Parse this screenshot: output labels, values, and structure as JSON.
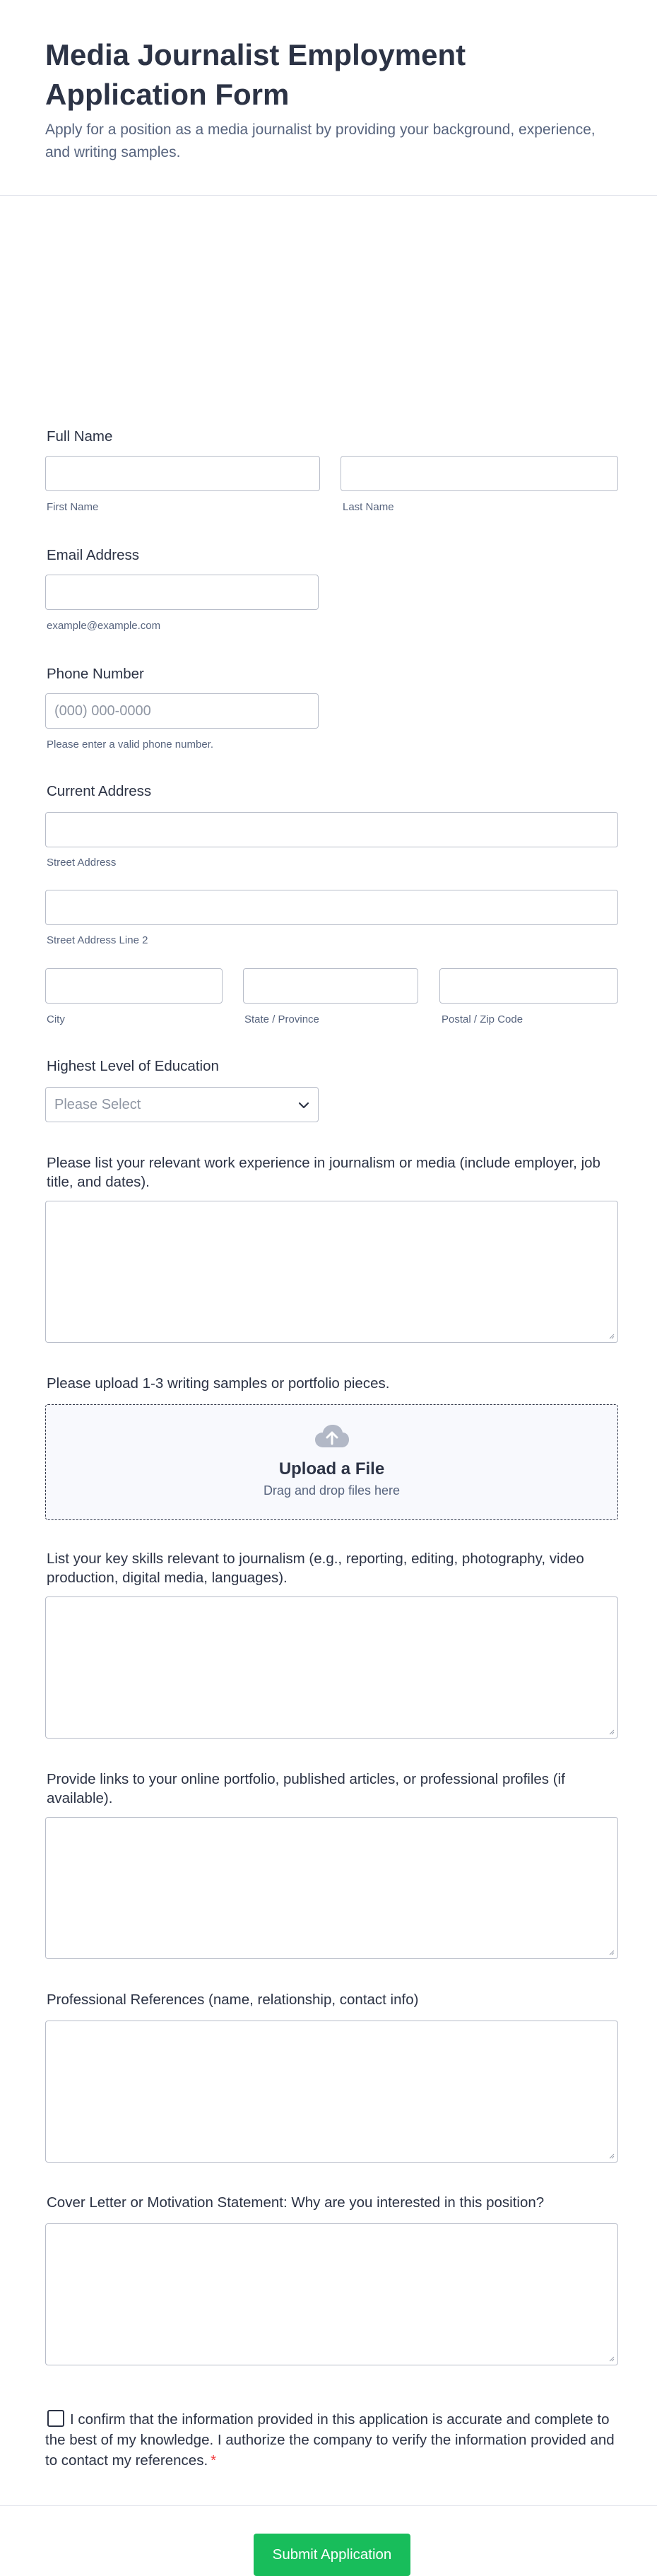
{
  "header": {
    "title": "Media Journalist Employment Application Form",
    "subtitle": "Apply for a position as a media journalist by providing your background, experience, and writing samples."
  },
  "full_name": {
    "label": "Full Name",
    "first_sublabel": "First Name",
    "last_sublabel": "Last Name"
  },
  "email": {
    "label": "Email Address",
    "sublabel": "example@example.com"
  },
  "phone": {
    "label": "Phone Number",
    "placeholder": "(000) 000-0000",
    "sublabel": "Please enter a valid phone number."
  },
  "address": {
    "label": "Current Address",
    "street_sublabel": "Street Address",
    "street2_sublabel": "Street Address Line 2",
    "city_sublabel": "City",
    "state_sublabel": "State / Province",
    "zip_sublabel": "Postal / Zip Code"
  },
  "education": {
    "label": "Highest Level of Education",
    "selected": "Please Select"
  },
  "experience": {
    "label": "Please list your relevant work experience in journalism or media (include employer, job title, and dates)."
  },
  "samples": {
    "label": "Please upload 1-3 writing samples or portfolio pieces.",
    "upload_title": "Upload a File",
    "upload_sub": "Drag and drop files here",
    "icon": "cloud-upload-icon"
  },
  "skills": {
    "label": "List your key skills relevant to journalism (e.g., reporting, editing, photography, video production, digital media, languages)."
  },
  "links": {
    "label": "Provide links to your online portfolio, published articles, or professional profiles (if available)."
  },
  "references": {
    "label": "Professional References (name, relationship, contact info)"
  },
  "cover_letter": {
    "label": "Cover Letter or Motivation Statement: Why are you interested in this position?"
  },
  "confirm": {
    "text": "I confirm that the information provided in this application is accurate and complete to the best of my knowledge. I authorize the company to verify the information provided and to contact my references.",
    "required_mark": "*"
  },
  "submit": {
    "label": "Submit Application"
  },
  "colors": {
    "text": "#2c3345",
    "muted": "#57647e",
    "border": "#b8bdc9",
    "submit_bg": "#18bd5b",
    "required": "#f23a3c",
    "upload_bg": "#f8f9fd"
  }
}
